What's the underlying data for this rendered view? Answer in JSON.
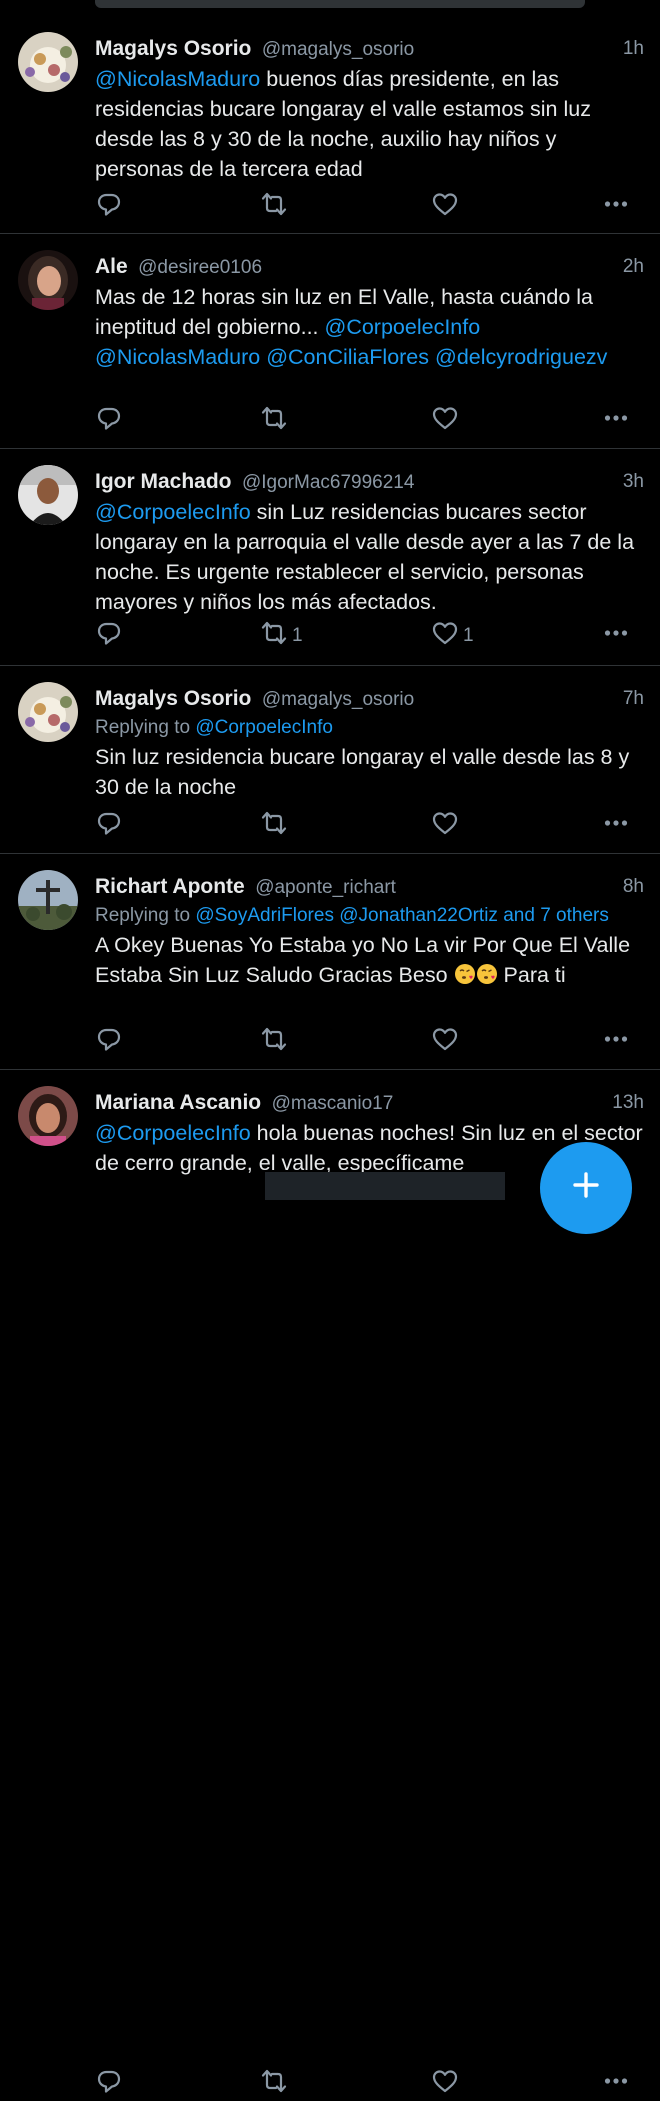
{
  "tweets": [
    {
      "name": "Magalys Osorio",
      "handle": "@magalys_osorio",
      "time": "1h",
      "reply_prefix": "",
      "reply_mentions": "",
      "parts": [
        {
          "t": "@NicolasMaduro",
          "m": true
        },
        {
          "t": " buenos días presidente, en las residencias bucare longaray el valle estamos sin luz desde las 8 y 30 de la noche, auxilio hay niños y personas de la tercera edad",
          "m": false
        }
      ],
      "retweets": "",
      "likes": ""
    },
    {
      "name": "Ale",
      "handle": "@desiree0106",
      "time": "2h",
      "reply_prefix": "",
      "reply_mentions": "",
      "parts": [
        {
          "t": "Mas de 12 horas sin luz en El Valle, hasta cuándo la ineptitud del gobierno... ",
          "m": false
        },
        {
          "t": "@CorpoelecInfo",
          "m": true
        },
        {
          "t": " ",
          "m": false
        },
        {
          "t": "@NicolasMaduro",
          "m": true
        },
        {
          "t": " ",
          "m": false
        },
        {
          "t": "@ConCiliaFlores",
          "m": true
        },
        {
          "t": " ",
          "m": false
        },
        {
          "t": "@delcyrodriguezv",
          "m": true
        }
      ],
      "retweets": "",
      "likes": ""
    },
    {
      "name": "Igor Machado",
      "handle": "@IgorMac67996214",
      "time": "3h",
      "reply_prefix": "",
      "reply_mentions": "",
      "parts": [
        {
          "t": "@CorpoelecInfo",
          "m": true
        },
        {
          "t": " sin Luz residencias bucares sector longaray en la parroquia el valle desde ayer a las 7 de la noche. Es urgente restablecer el servicio, personas mayores y niños los más afectados.",
          "m": false
        }
      ],
      "retweets": "1",
      "likes": "1"
    },
    {
      "name": "Magalys Osorio",
      "handle": "@magalys_osorio",
      "time": "7h",
      "reply_prefix": "Replying to ",
      "reply_mentions": "@CorpoelecInfo",
      "parts": [
        {
          "t": "Sin luz residencia bucare longaray el valle desde las 8 y 30 de la noche",
          "m": false
        }
      ],
      "retweets": "",
      "likes": ""
    },
    {
      "name": "Richart Aponte",
      "handle": "@aponte_richart",
      "time": "8h",
      "reply_prefix": "Replying to ",
      "reply_mentions": "@SoyAdriFlores @Jonathan22Ortiz and 7 others",
      "parts": [
        {
          "t": "A Okey Buenas Yo Estaba yo No La vir Por Que El Valle Estaba Sin Luz Saludo Gracias Beso ",
          "m": false
        },
        {
          "t": "EMOJI",
          "m": false,
          "emoji": true
        },
        {
          "t": " Para ti",
          "m": false
        }
      ],
      "retweets": "",
      "likes": ""
    },
    {
      "name": "Mariana Ascanio",
      "handle": "@mascanio17",
      "time": "13h",
      "reply_prefix": "",
      "reply_mentions": "",
      "parts": [
        {
          "t": "@CorpoelecInfo",
          "m": true
        },
        {
          "t": " hola buenas noches! Sin luz en el sector de cerro grande, el valle, específicame",
          "m": false
        }
      ],
      "retweets": "",
      "likes": ""
    }
  ],
  "fab": {
    "icon": "compose-plus-icon"
  },
  "colors": {
    "accent": "#1d9bf0",
    "background": "#000000",
    "secondary_text": "#8b98a5"
  }
}
